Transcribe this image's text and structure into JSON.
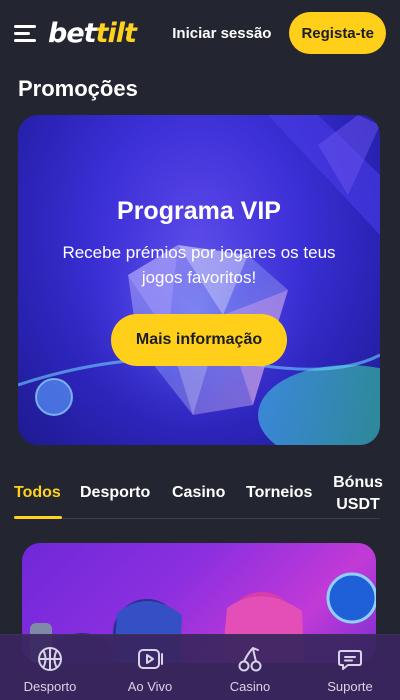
{
  "header": {
    "logo_part1": "bet",
    "logo_part2": "tilt",
    "login_label": "Iniciar sessão",
    "register_label": "Regista-te"
  },
  "page_title": "Promoções",
  "banner": {
    "title": "Programa VIP",
    "subtitle": "Recebe prémios por jogares os teus jogos favoritos!",
    "button_label": "Mais informação"
  },
  "tabs": [
    {
      "label": "Todos",
      "active": true
    },
    {
      "label": "Desporto",
      "active": false
    },
    {
      "label": "Casino",
      "active": false
    },
    {
      "label": "Torneios",
      "active": false
    },
    {
      "label": "Bónus USDT",
      "active": false
    }
  ],
  "bottom_nav": [
    {
      "label": "Desporto",
      "icon": "basketball-icon"
    },
    {
      "label": "Ao Vivo",
      "icon": "live-video-icon"
    },
    {
      "label": "Casino",
      "icon": "cherries-icon"
    },
    {
      "label": "Suporte",
      "icon": "chat-support-icon"
    }
  ],
  "colors": {
    "accent": "#ffcf1a",
    "background": "#232530",
    "banner": "#3b2fd6",
    "nav": "#3a2660"
  }
}
